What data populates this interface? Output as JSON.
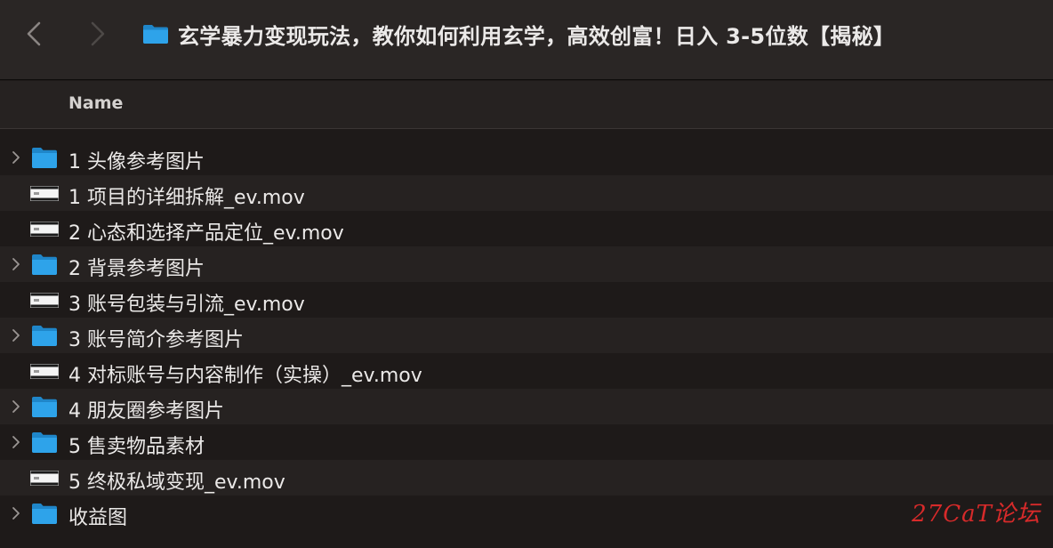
{
  "window": {
    "title": "玄学暴力变现玩法，教你如何利用玄学，高效创富！日入 3-5位数【揭秘】"
  },
  "toolbar": {
    "back_icon": "chevron-left-icon",
    "forward_icon": "chevron-right-icon"
  },
  "columns": {
    "name": "Name"
  },
  "colors": {
    "folder": "#2ea3ea",
    "background": "#1e1a19",
    "row_alt": "#262221",
    "watermark": "#d72a2a"
  },
  "items": [
    {
      "type": "folder",
      "label": "1  头像参考图片"
    },
    {
      "type": "movie",
      "label": "1  项目的详细拆解_ev.mov"
    },
    {
      "type": "movie",
      "label": "2  心态和选择产品定位_ev.mov"
    },
    {
      "type": "folder",
      "label": "2  背景参考图片"
    },
    {
      "type": "movie",
      "label": "3  账号包装与引流_ev.mov"
    },
    {
      "type": "folder",
      "label": "3  账号简介参考图片"
    },
    {
      "type": "movie",
      "label": "4  对标账号与内容制作（实操）_ev.mov"
    },
    {
      "type": "folder",
      "label": "4  朋友圈参考图片"
    },
    {
      "type": "folder",
      "label": "5  售卖物品素材"
    },
    {
      "type": "movie",
      "label": "5  终极私域变现_ev.mov"
    },
    {
      "type": "folder",
      "label": "收益图"
    }
  ],
  "watermark": {
    "text": "27CaT论坛"
  }
}
